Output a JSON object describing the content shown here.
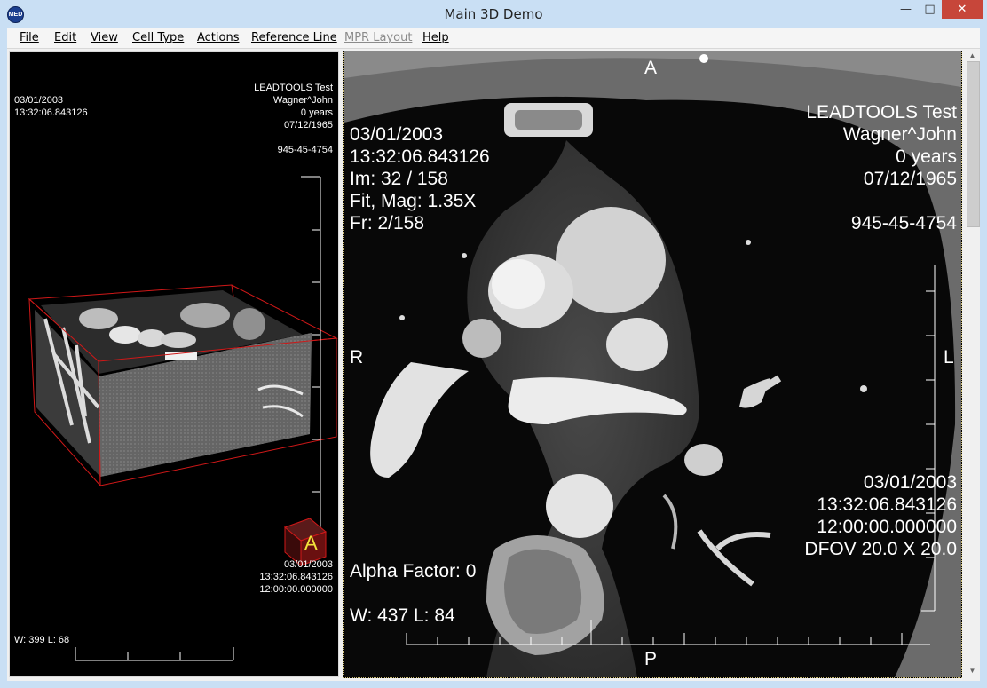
{
  "window": {
    "title": "Main 3D Demo",
    "app_icon_text": "MED",
    "minimize_glyph": "—",
    "maximize_glyph": "□",
    "close_glyph": "✕"
  },
  "menu": {
    "items": [
      {
        "label": "File",
        "enabled": true
      },
      {
        "label": "Edit",
        "enabled": true
      },
      {
        "label": "View",
        "enabled": true
      },
      {
        "label": "Cell Type",
        "enabled": true
      },
      {
        "label": "Actions",
        "enabled": true
      },
      {
        "label": "Reference Line",
        "enabled": true
      },
      {
        "label": "MPR Layout",
        "enabled": false
      },
      {
        "label": "Help",
        "enabled": true
      }
    ]
  },
  "left_cell": {
    "top_left": "03/01/2003\n13:32:06.843126",
    "top_right": "LEADTOOLS Test\nWagner^John\n0 years\n07/12/1965",
    "patient_id": "945-45-4754",
    "bottom_right": "03/01/2003\n13:32:06.843126\n12:00:00.000000",
    "window_level": "W: 399 L: 68",
    "orientation_cube_label": "A",
    "accent_color": "#e01010"
  },
  "right_cell": {
    "top_marker": "A",
    "bottom_marker": "P",
    "left_marker": "R",
    "right_marker": "L",
    "top_left": "03/01/2003\n13:32:06.843126\nIm: 32 / 158\nFit, Mag: 1.35X\nFr: 2/158",
    "top_right": "LEADTOOLS Test\nWagner^John\n0 years\n07/12/1965",
    "patient_id": "945-45-4754",
    "bottom_right": "03/01/2003\n13:32:06.843126\n12:00:00.000000\nDFOV 20.0 X 20.0",
    "alpha_factor": "Alpha Factor: 0",
    "window_level": "W: 437 L: 84",
    "frame_color": "#c8b870"
  }
}
